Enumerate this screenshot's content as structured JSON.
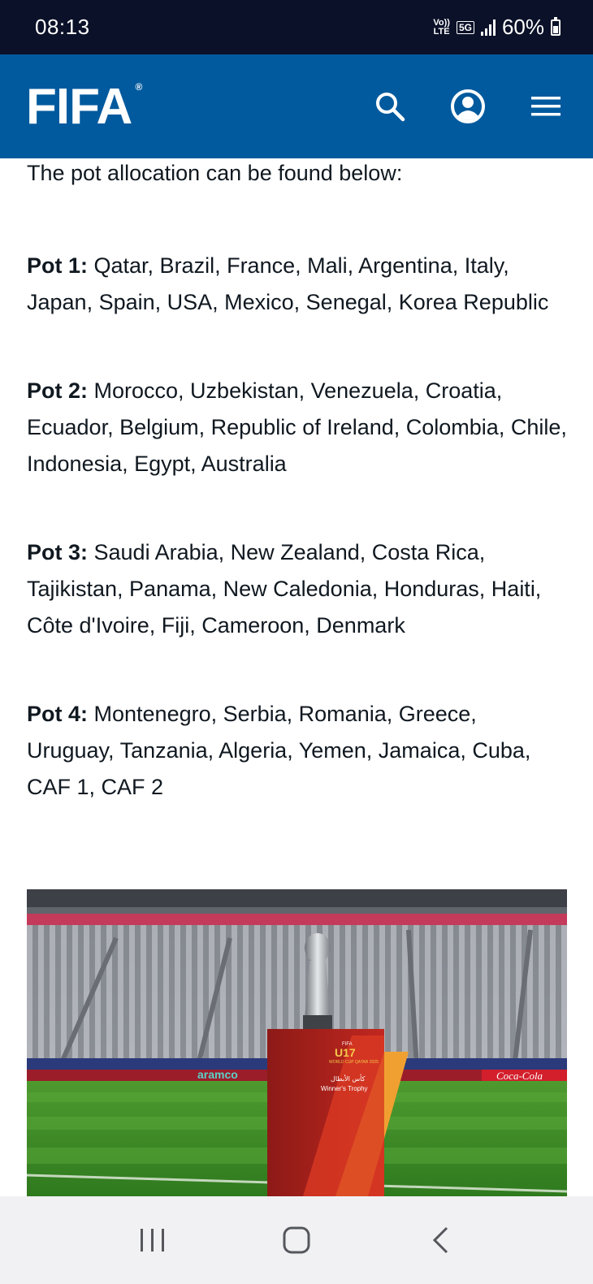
{
  "status_bar": {
    "time": "08:13",
    "network_top": "Vo))",
    "network_bottom": "LTE",
    "network_5g": "5G",
    "battery": "60%"
  },
  "header": {
    "logo_text": "FIFA",
    "logo_mark": "®",
    "icons": [
      "search-icon",
      "account-icon",
      "menu-icon"
    ]
  },
  "article": {
    "intro": "The pot allocation can be found below:",
    "pots": [
      {
        "label": "Pot 1:",
        "teams": " Qatar, Brazil, France, Mali, Argentina, Italy, Japan, Spain, USA, Mexico, Senegal, Korea Republic"
      },
      {
        "label": "Pot 2:",
        "teams": " Morocco, Uzbekistan, Venezuela, Croatia, Ecuador, Belgium, Republic of Ireland, Colombia, Chile, Indonesia, Egypt, Australia"
      },
      {
        "label": "Pot 3:",
        "teams": " Saudi Arabia, New Zealand, Costa Rica, Tajikistan, Panama, New Caledonia, Honduras, Haiti, Côte d'Ivoire, Fiji, Cameroon, Denmark"
      },
      {
        "label": "Pot 4:",
        "teams": " Montenegro, Serbia, Romania, Greece, Uruguay, Tanzania, Algeria, Yemen, Jamaica, Cuba, CAF 1, CAF 2"
      }
    ]
  },
  "photo": {
    "board_text": "aramco",
    "trophy_brand": "FIFA",
    "trophy_title": "U17",
    "trophy_sub": "WORLD CUP QATAR 2025",
    "trophy_arabic": "كأس الأبطال",
    "trophy_caption": "Winner's Trophy",
    "board_right": "Coca-Cola"
  },
  "colors": {
    "header": "#025a9e",
    "status_bar": "#0a1128",
    "nav_bar": "#f1f1f3"
  },
  "nav_bar": {
    "icons": [
      "recents-icon",
      "home-icon",
      "back-icon"
    ]
  }
}
